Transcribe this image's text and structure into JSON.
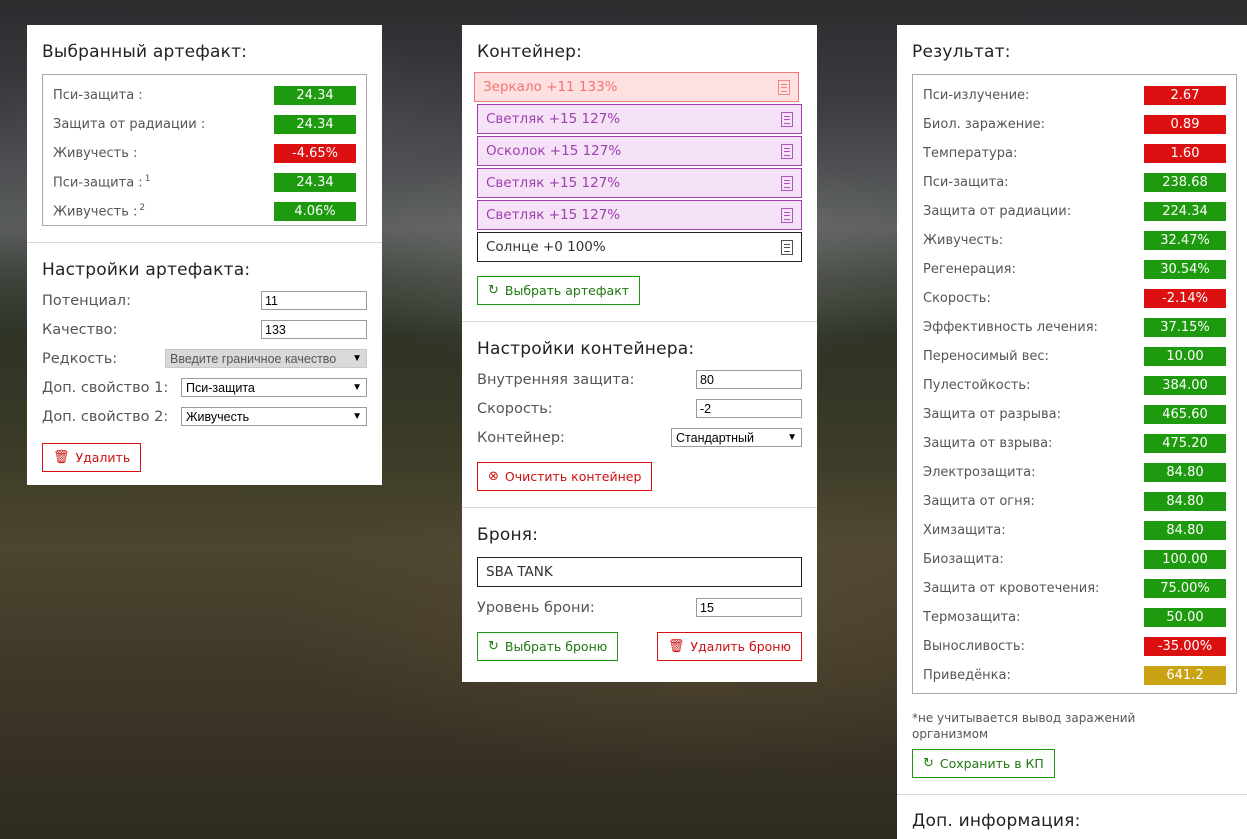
{
  "selected_artifact": {
    "title": "Выбранный артефакт:",
    "stats": [
      {
        "label": "Пси-защита :",
        "sup": "",
        "value": "24.34",
        "color": "green"
      },
      {
        "label": "Защита от радиации :",
        "sup": "",
        "value": "24.34",
        "color": "green"
      },
      {
        "label": "Живучесть :",
        "sup": "",
        "value": "-4.65%",
        "color": "red"
      },
      {
        "label": "Пси-защита :",
        "sup": "1",
        "value": "24.34",
        "color": "green"
      },
      {
        "label": "Живучесть :",
        "sup": "2",
        "value": "4.06%",
        "color": "green"
      }
    ]
  },
  "artifact_settings": {
    "title": "Настройки артефакта:",
    "potential_label": "Потенциал:",
    "potential_value": "11",
    "quality_label": "Качество:",
    "quality_value": "133",
    "rarity_label": "Редкость:",
    "rarity_value": "Введите граничное качество",
    "extra1_label": "Доп. свойство 1:",
    "extra1_value": "Пси-защита",
    "extra2_label": "Доп. свойство 2:",
    "extra2_value": "Живучесть",
    "delete_label": "Удалить"
  },
  "container": {
    "title": "Контейнер:",
    "slots": [
      {
        "label": "Зеркало +11 133%",
        "style": "red-slot"
      },
      {
        "label": "Светляк +15 127%",
        "style": "purple"
      },
      {
        "label": "Осколок +15 127%",
        "style": "purple"
      },
      {
        "label": "Светляк +15 127%",
        "style": "purple"
      },
      {
        "label": "Светляк +15 127%",
        "style": "purple"
      },
      {
        "label": "Солнце +0 100%",
        "style": "plain"
      }
    ],
    "choose_label": "Выбрать артефакт"
  },
  "container_settings": {
    "title": "Настройки контейнера:",
    "inner_label": "Внутренняя защита:",
    "inner_value": "80",
    "speed_label": "Скорость:",
    "speed_value": "-2",
    "container_label": "Контейнер:",
    "container_value": "Стандартный",
    "clear_label": "Очистить контейнер"
  },
  "armor": {
    "title": "Броня:",
    "name": "SBA TANK",
    "level_label": "Уровень брони:",
    "level_value": "15",
    "choose_label": "Выбрать броню",
    "delete_label": "Удалить броню"
  },
  "result": {
    "title": "Результат:",
    "stats": [
      {
        "label": "Пси-излучение:",
        "value": "2.67",
        "color": "red"
      },
      {
        "label": "Биол. заражение:",
        "value": "0.89",
        "color": "red"
      },
      {
        "label": "Температура:",
        "value": "1.60",
        "color": "red"
      },
      {
        "label": "Пси-защита:",
        "value": "238.68",
        "color": "green"
      },
      {
        "label": "Защита от радиации:",
        "value": "224.34",
        "color": "green"
      },
      {
        "label": "Живучесть:",
        "value": "32.47%",
        "color": "green"
      },
      {
        "label": "Регенерация:",
        "value": "30.54%",
        "color": "green"
      },
      {
        "label": "Скорость:",
        "value": "-2.14%",
        "color": "red"
      },
      {
        "label": "Эффективность лечения:",
        "value": "37.15%",
        "color": "green"
      },
      {
        "label": "Переносимый вес:",
        "value": "10.00",
        "color": "green"
      },
      {
        "label": "Пулестойкость:",
        "value": "384.00",
        "color": "green"
      },
      {
        "label": "Защита от разрыва:",
        "value": "465.60",
        "color": "green"
      },
      {
        "label": "Защита от взрыва:",
        "value": "475.20",
        "color": "green"
      },
      {
        "label": "Электрозащита:",
        "value": "84.80",
        "color": "green"
      },
      {
        "label": "Защита от огня:",
        "value": "84.80",
        "color": "green"
      },
      {
        "label": "Химзащита:",
        "value": "84.80",
        "color": "green"
      },
      {
        "label": "Биозащита:",
        "value": "100.00",
        "color": "green"
      },
      {
        "label": "Защита от кровотечения:",
        "value": "75.00%",
        "color": "green"
      },
      {
        "label": "Термозащита:",
        "value": "50.00",
        "color": "green"
      },
      {
        "label": "Выносливость:",
        "value": "-35.00%",
        "color": "red"
      },
      {
        "label": "Приведёнка:",
        "value": "641.2",
        "color": "gold"
      }
    ],
    "note": "*не учитывается вывод заражений организмом",
    "save_label": "Сохранить в КП"
  },
  "extra_info": {
    "title": "Доп. информация:"
  },
  "colors": {
    "green": "#1d9a0e",
    "red": "#dc1010",
    "gold": "#c9a314",
    "purple_slot": "#a03fb0",
    "red_slot": "#f47a7a"
  }
}
